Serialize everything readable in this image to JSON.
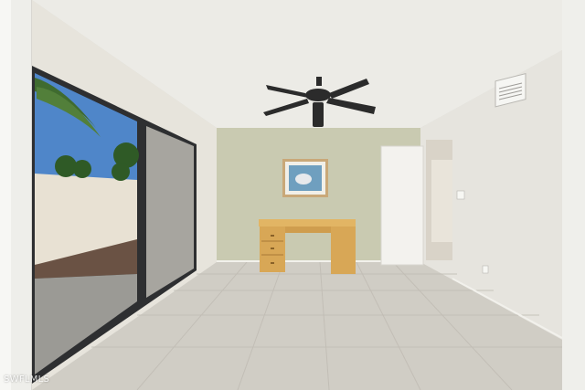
{
  "photo": {
    "watermark": "SWFLMLS"
  },
  "colors": {
    "ceiling": "#ecebe6",
    "back_wall": "#c9cab1",
    "right_wall": "#e6e4de",
    "left_wall": "#e7e4dc",
    "floor": "#d0cdc5",
    "desk": "#dcae5c",
    "door": "#f3f2ee",
    "sky": "#4f86c9"
  }
}
